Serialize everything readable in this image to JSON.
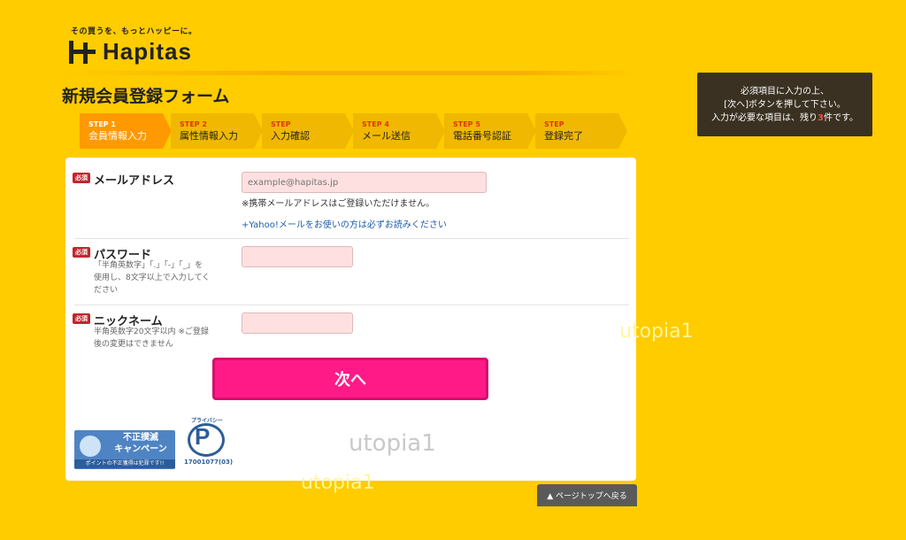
{
  "header": {
    "tagline": "その買うを、もっとハッピーに。",
    "logo_text": "Hapitas"
  },
  "page_title": "新規会員登録フォーム",
  "steps": [
    {
      "num": "STEP 1",
      "label": "会員情報入力",
      "active": true
    },
    {
      "num": "STEP 2",
      "label": "属性情報入力",
      "active": false
    },
    {
      "num": "STEP",
      "label": "入力確認",
      "active": false
    },
    {
      "num": "STEP 4",
      "label": "メール送信",
      "active": false
    },
    {
      "num": "STEP 5",
      "label": "電話番号認証",
      "active": false
    },
    {
      "num": "STEP",
      "label": "登録完了",
      "active": false
    }
  ],
  "notice": {
    "line1": "必須項目に入力の上、",
    "line2": "[次へ]ボタンを押して下さい。",
    "line3_pre": "入力が必要な項目は、残り",
    "count": "3",
    "line3_post": "件です。"
  },
  "form": {
    "required_badge": "必須",
    "email": {
      "label": "メールアドレス",
      "value": "",
      "placeholder": "example@hapitas.jp",
      "note": "※携帯メールアドレスはご登録いただけません。",
      "link": "+Yahoo!メールをお使いの方は必ずお読みください"
    },
    "password": {
      "label": "パスワード",
      "hint_line1": "「半角英数字」「.」「-」「_」を",
      "hint_line2": "使用し、8文字以上で入力してく",
      "hint_line3": "ださい",
      "value": ""
    },
    "nickname": {
      "label": "ニックネーム",
      "hint_line1": "半角英数字20文字以内 ※ご登録",
      "hint_line2": "後の変更はできません",
      "value": ""
    },
    "next_button": "次へ"
  },
  "badges": {
    "campaign_title_line1": "不正撲滅",
    "campaign_title_line2": "キャンペーン",
    "campaign_sub": "ポイントの不正獲得は犯罪です!!",
    "privacy_top": "プライバシー",
    "privacy_mark": "P",
    "privacy_number": "17001077(03)"
  },
  "watermarks": [
    "utopia1",
    "utopia1",
    "utopia1"
  ],
  "page_top_button": "▲ ページトップへ戻る",
  "colors": {
    "background": "#ffcc00",
    "active_step": "#ff9900",
    "next_button": "#ff1a88",
    "required": "#c1272d",
    "notice_bg": "#3a3122"
  }
}
